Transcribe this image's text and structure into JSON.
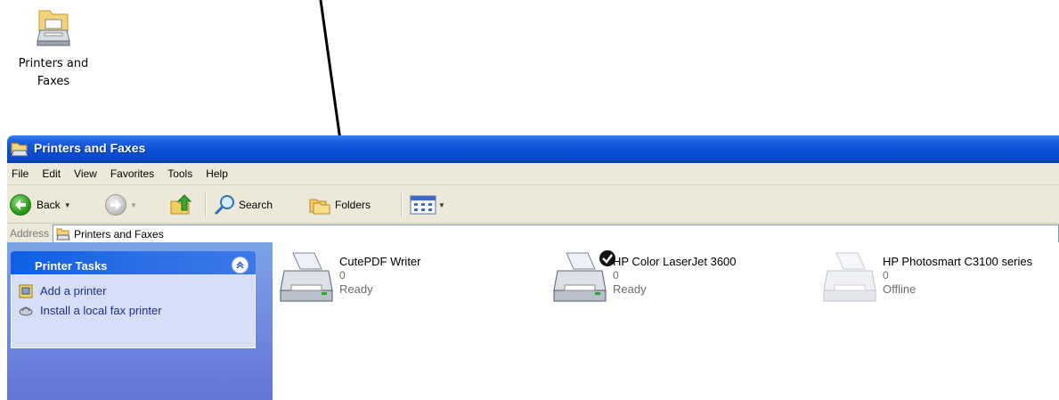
{
  "desktop_icon": {
    "label_line1": "Printers and",
    "label_line2": "Faxes"
  },
  "window": {
    "title": "Printers and Faxes",
    "menu": [
      "File",
      "Edit",
      "View",
      "Favorites",
      "Tools",
      "Help"
    ],
    "toolbar": {
      "back_label": "Back",
      "search_label": "Search",
      "folders_label": "Folders"
    },
    "address": {
      "label": "Address",
      "value": "Printers and Faxes"
    },
    "task_pane": {
      "title": "Printer Tasks",
      "collapse_glyph": "»",
      "tasks": [
        {
          "label": "Add a printer",
          "icon": "add-printer-icon"
        },
        {
          "label": "Install a local fax printer",
          "icon": "fax-icon"
        }
      ]
    },
    "printers": [
      {
        "name": "CutePDF Writer",
        "count": "0",
        "status": "Ready",
        "default": false
      },
      {
        "name": "HP Color LaserJet 3600",
        "count": "0",
        "status": "Ready",
        "default": true
      },
      {
        "name": "HP Photosmart C3100 series",
        "count": "0",
        "status": "Offline",
        "default": false
      }
    ]
  },
  "colors": {
    "titlebar_blue": "#0a4fd7",
    "chrome": "#ece9d8",
    "task_pane": "#6f8de0",
    "task_link": "#1a2f8f",
    "status_gray": "#6d6d6d"
  }
}
